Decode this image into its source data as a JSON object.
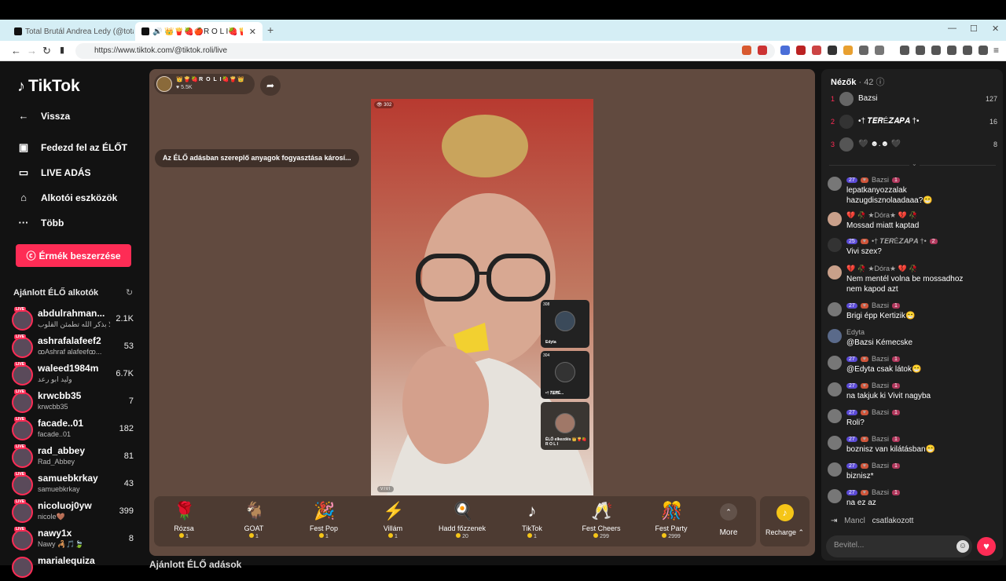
{
  "browser": {
    "tabs": [
      {
        "title": "Total Brutál Andrea Ledy (@total"
      },
      {
        "title": "🔊 👑🍟🍓🍎R O L I🍓🍟🍎 (@tik"
      }
    ],
    "new_tab": "+",
    "url": "https://www.tiktok.com/@tiktok.roli/live",
    "controls": {
      "minimize": "—",
      "maximize": "☐",
      "close": "✕"
    },
    "back": "←",
    "forward": "→",
    "reload": "↻"
  },
  "sidebar": {
    "logo_text": "TikTok",
    "nav": [
      {
        "label": "Vissza",
        "icon": "arrow-left-icon"
      },
      {
        "label": "Fedezd fel az ÉLŐT",
        "icon": "tv-icon"
      },
      {
        "label": "LIVE ADÁS",
        "icon": "camera-icon"
      },
      {
        "label": "Alkotói eszközök",
        "icon": "tools-icon"
      },
      {
        "label": "Több",
        "icon": "more-icon"
      }
    ],
    "coins_button": "Érmék beszerzése",
    "recommended_title": "Ajánlott ÉLŐ alkotók",
    "creators": [
      {
        "name": "abdulrahman...",
        "sub": "ألا بذكر الله تطمئن القلوب",
        "count": "2.1K"
      },
      {
        "name": "ashrafalafeef2",
        "sub": "ꝏAshraf alafeefꝏ...",
        "count": "53"
      },
      {
        "name": "waleed1984m",
        "sub": "وليد ابو رعد",
        "count": "6.7K"
      },
      {
        "name": "krwcbb35",
        "sub": "krwcbb35",
        "count": "7"
      },
      {
        "name": "facade..01",
        "sub": "facade..01",
        "count": "182"
      },
      {
        "name": "rad_abbey",
        "sub": "Rad_Abbey",
        "count": "81"
      },
      {
        "name": "samuebkrkay",
        "sub": "samuebkrkay",
        "count": "43"
      },
      {
        "name": "nicoluoj0yw",
        "sub": "nicole🤎",
        "count": "399"
      },
      {
        "name": "nawy1x",
        "sub": "Nawy 🦂🎵🍃",
        "count": "8"
      },
      {
        "name": "marialequiza",
        "sub": "",
        "count": ""
      }
    ],
    "live_badge": "LIVE"
  },
  "stage": {
    "host_name": "👑🍟🍓R O L I🍓🍟👑",
    "host_likes": "5.5K",
    "warning": "Az ÉLŐ adásban szereplő anyagok fogyasztása károsí...",
    "video_viewers": "302",
    "watermark": "VIVI",
    "guests": [
      {
        "viewers": "308",
        "name": "Edyta"
      },
      {
        "viewers": "304",
        "name": "•† 𝑻𝑬𝑹É..."
      },
      {
        "viewers": "",
        "name": "ÉLŐ elkezdés 👑🍟🍓R O L I"
      }
    ]
  },
  "gifts": [
    {
      "name": "Rózsa",
      "price": "1",
      "icon": "rose-icon",
      "glyph": "🌹"
    },
    {
      "name": "GOAT",
      "price": "1",
      "icon": "goat-icon",
      "glyph": "🐐"
    },
    {
      "name": "Fest Pop",
      "price": "1",
      "icon": "festpop-icon",
      "glyph": "🎉"
    },
    {
      "name": "Villám",
      "price": "1",
      "icon": "lightning-icon",
      "glyph": "⚡"
    },
    {
      "name": "Hadd főzzenek",
      "price": "20",
      "icon": "cook-icon",
      "glyph": "🍳"
    },
    {
      "name": "TikTok",
      "price": "1",
      "icon": "tiktok-gift-icon",
      "glyph": "♪"
    },
    {
      "name": "Fest Cheers",
      "price": "299",
      "icon": "cheers-icon",
      "glyph": "🥂"
    },
    {
      "name": "Fest Party",
      "price": "2999",
      "icon": "party-icon",
      "glyph": "🎊"
    }
  ],
  "more_label": "More",
  "recharge_label": "Recharge ⌃",
  "viewers_panel": {
    "title": "Nézők",
    "count": "· 42",
    "top": [
      {
        "rank": "1",
        "name": "Bazsi",
        "score": "127"
      },
      {
        "rank": "2",
        "name": "•† 𝑻𝑬𝑹É𝒁𝑨𝑷𝑨 †•",
        "score": "16"
      },
      {
        "rank": "3",
        "name": "🖤 ☻.☻ 🖤",
        "score": "8"
      }
    ]
  },
  "chat": [
    {
      "user": "Bazsi",
      "lvl": "27",
      "fan": "1",
      "text": "lepatkanyozzalak hazugdisznolaadaaa?😁"
    },
    {
      "user": "💔 🥀 ★Dóra★ 💔 🥀",
      "lvl": "",
      "fan": "",
      "text": "Mossad miatt kaptad"
    },
    {
      "user": "•† 𝑻𝑬𝑹É𝒁𝑨𝑷𝑨 †•",
      "lvl": "25",
      "fan": "2",
      "text": "Vivi szex?"
    },
    {
      "user": "💔 🥀 ★Dóra★ 💔 🥀",
      "lvl": "",
      "fan": "",
      "text": "Nem mentél volna be mossadhoz nem kapod azt"
    },
    {
      "user": "Bazsi",
      "lvl": "27",
      "fan": "1",
      "text": "Brigi épp Kertizik😁"
    },
    {
      "user": "Edyta",
      "lvl": "",
      "fan": "",
      "text": "@Bazsi Kémecske"
    },
    {
      "user": "Bazsi",
      "lvl": "27",
      "fan": "1",
      "text": "@Edyta csak látok😁"
    },
    {
      "user": "Bazsi",
      "lvl": "27",
      "fan": "1",
      "text": "na takjuk ki Vivit nagyba"
    },
    {
      "user": "Bazsi",
      "lvl": "27",
      "fan": "1",
      "text": "Roli?"
    },
    {
      "user": "Bazsi",
      "lvl": "27",
      "fan": "1",
      "text": "boznisz van kilátásban😁"
    },
    {
      "user": "Bazsi",
      "lvl": "27",
      "fan": "1",
      "text": "biznisz*"
    },
    {
      "user": "Bazsi",
      "lvl": "27",
      "fan": "1",
      "text": "na ez az"
    }
  ],
  "joined": {
    "user": "Mancl",
    "text": "csatlakozott"
  },
  "input_placeholder": "Bevitel...",
  "more_recommended": "Ajánlott ÉLŐ adások"
}
